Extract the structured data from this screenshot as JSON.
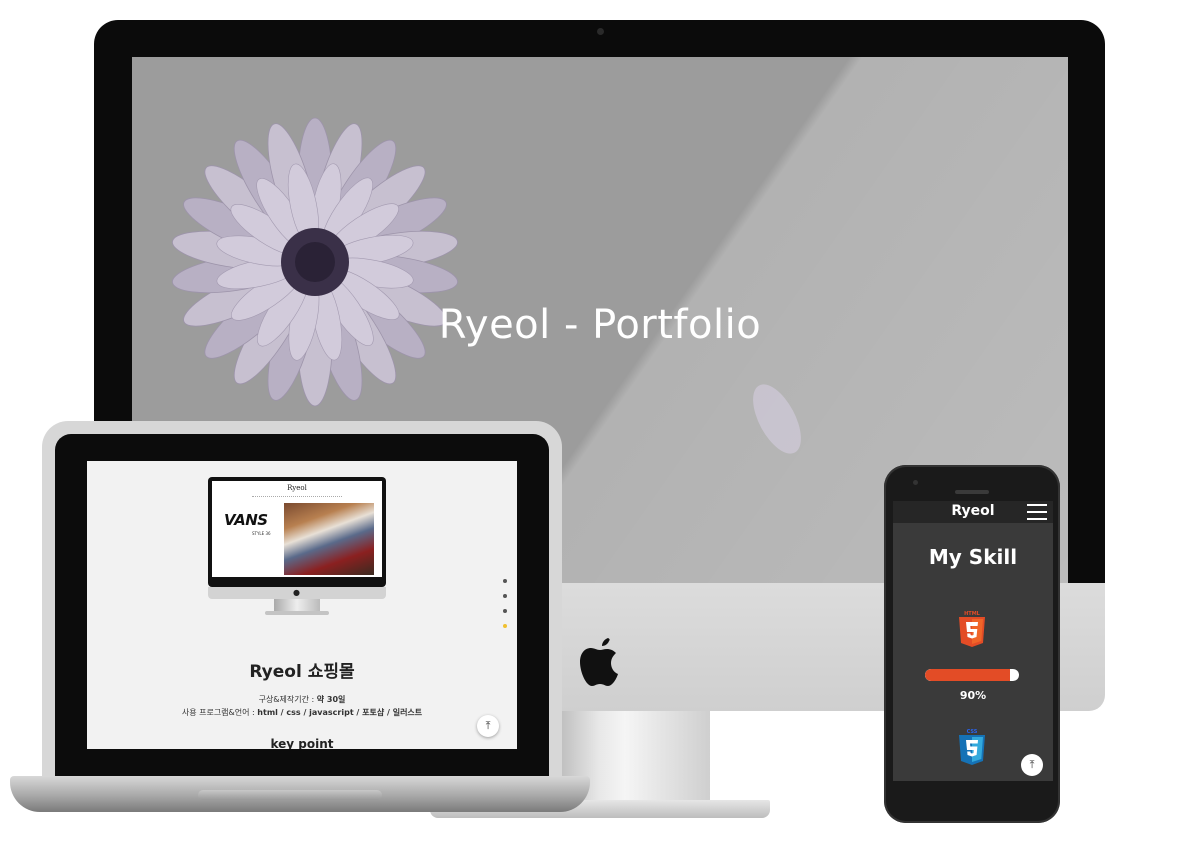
{
  "desktop": {
    "hero_title": "Ryeol - Portfolio"
  },
  "laptop": {
    "preview": {
      "brand": "Ryeol",
      "banner_logo": "VANS",
      "banner_sub": "STYLE 36"
    },
    "project_title": "Ryeol 쇼핑몰",
    "period_label": "구상&제작기간 :",
    "period_value": "약 30일",
    "tools_label": "사용 프로그램&언어 :",
    "tools_value": "html / css / javascript / 포토샵 / 일러스트",
    "key_point": "key point",
    "nav_dots_active_index": 3,
    "top_button_icon": "arrow-up-to-top-icon"
  },
  "phone": {
    "brand": "Ryeol",
    "menu_icon": "hamburger-menu-icon",
    "section_title": "My Skill",
    "skills": [
      {
        "name": "HTML",
        "icon": "html5-icon",
        "level": 0.9,
        "percent_label": "90%",
        "color": "#e34c26"
      },
      {
        "name": "CSS",
        "icon": "css3-icon",
        "color": "#2965f1"
      }
    ],
    "top_button_icon": "arrow-up-to-top-icon"
  },
  "colors": {
    "hero_bg": "#9c9c9c",
    "accent_dot": "#f0c030",
    "html_orange": "#e34c26",
    "css_blue": "#2965f1"
  }
}
